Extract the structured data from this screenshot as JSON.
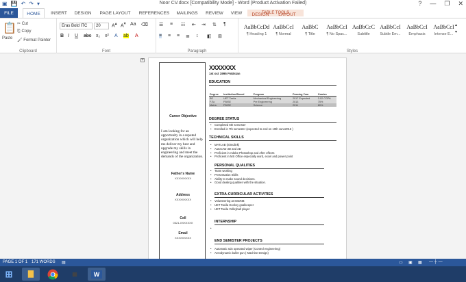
{
  "titlebar": {
    "title": "Noor CV.docx [Compatibility Mode] - Word (Product Activation Failed)",
    "help": "?",
    "minimize": "—",
    "restore": "❐",
    "close": "✕"
  },
  "ribbon_tabs": {
    "file": "FILE",
    "home": "HOME",
    "insert": "INSERT",
    "design": "DESIGN",
    "page_layout": "PAGE LAYOUT",
    "references": "REFERENCES",
    "mailings": "MAILINGS",
    "review": "REVIEW",
    "view": "VIEW",
    "table_tools": "TABLE TOOLS",
    "tt_design": "DESIGN",
    "tt_layout": "LAYOUT"
  },
  "clipboard": {
    "paste": "Paste",
    "cut": "Cut",
    "copy": "Copy",
    "format_painter": "Format Painter",
    "label": "Clipboard"
  },
  "font": {
    "name": "Eras Bold ITC",
    "size": "20",
    "label": "Font"
  },
  "paragraph": {
    "label": "Paragraph"
  },
  "styles": {
    "label": "Styles",
    "items": [
      {
        "sample": "AaBbCcDd",
        "name": "¶ Heading 1"
      },
      {
        "sample": "AaBbCcI",
        "name": "¶ Normal"
      },
      {
        "sample": "AaBbC",
        "name": "¶ Title"
      },
      {
        "sample": "AaBbCcI",
        "name": "¶ No Spac..."
      },
      {
        "sample": "AaBbCcC",
        "name": "Subtitle"
      },
      {
        "sample": "AaBbCcI",
        "name": "Subtle Em..."
      },
      {
        "sample": "AaBbCcI",
        "name": "Emphasis"
      },
      {
        "sample": "AaBbCcI",
        "name": "Intense E..."
      }
    ]
  },
  "document": {
    "name": "XXXXXXX",
    "dob": "1st oct 1995 Pakistan",
    "left": {
      "objective_title": "Career Objective",
      "objective_text": "I am looking for an opportunity in a reputed organization which will help me deliver my best and upgrade my skills in engineering and meet the demands of the organization.",
      "father_label": "Father's Name",
      "father_value": "XXXXXXXXX",
      "address_label": "Address",
      "address_value": "XXXXXXXXX",
      "cell_label": "Cell",
      "cell_value": "0321-XXXXXXX",
      "email_label": "Email",
      "email_value": "XXXXXXXXX"
    },
    "education": {
      "title": "EDUCATION",
      "headers": [
        "Degree",
        "Institution/Board",
        "Program",
        "Passing Year",
        "Grades"
      ],
      "rows": [
        [
          "BE",
          "UET Taxila",
          "Mechanical Engineering",
          "2017 Expected",
          "3.02 CGPA"
        ],
        [
          "F.Sc",
          "FBISE",
          "Pre Engineering",
          "2013",
          "75%"
        ],
        [
          "Matric",
          "FBISE",
          "Science",
          "2011",
          "80%"
        ]
      ]
    },
    "degree_status": {
      "title": "DEGREE STATUS",
      "items": [
        "Completed 6th semester",
        "Enrolled in 7th semester (expected to end on 10th June2016 )"
      ]
    },
    "technical_skills": {
      "title": "TECHNICAL SKILLS",
      "items": [
        "MATLAB (Simulink)",
        "AutoCAD 3D and 2D",
        "Proficient in Adobe Photoshop and After effects",
        "Proficient in MS Office especially word, excel and power point"
      ]
    },
    "personal_qualities": {
      "title": "PERSONAL QUALITIES",
      "items": [
        "Team working",
        "Presentation Skills",
        "Ability to make sound decisions.",
        "Good dealing qualities with the situation."
      ]
    },
    "extra_curricular": {
      "title": "EXTRA-CURRICULAR ACTIVITIES",
      "items": [
        "Volunteering at SSDNB",
        "UET Taxila Hockey goalkeeper",
        "UET Taxila Volleyball player"
      ]
    },
    "internship": {
      "title": "INTERNSHIP",
      "items": [
        ""
      ]
    },
    "end_semester": {
      "title": "END SEMISTER PROJECTS",
      "items": [
        "Automatic rain operated wiper (Control engineering)",
        "Aerodynamic bullet gun ( Machine Design)"
      ]
    }
  },
  "statusbar": {
    "page": "PAGE 1 OF 1",
    "words": "171 WORDS"
  },
  "taskbar": {
    "start": "⊞",
    "word": "W"
  }
}
